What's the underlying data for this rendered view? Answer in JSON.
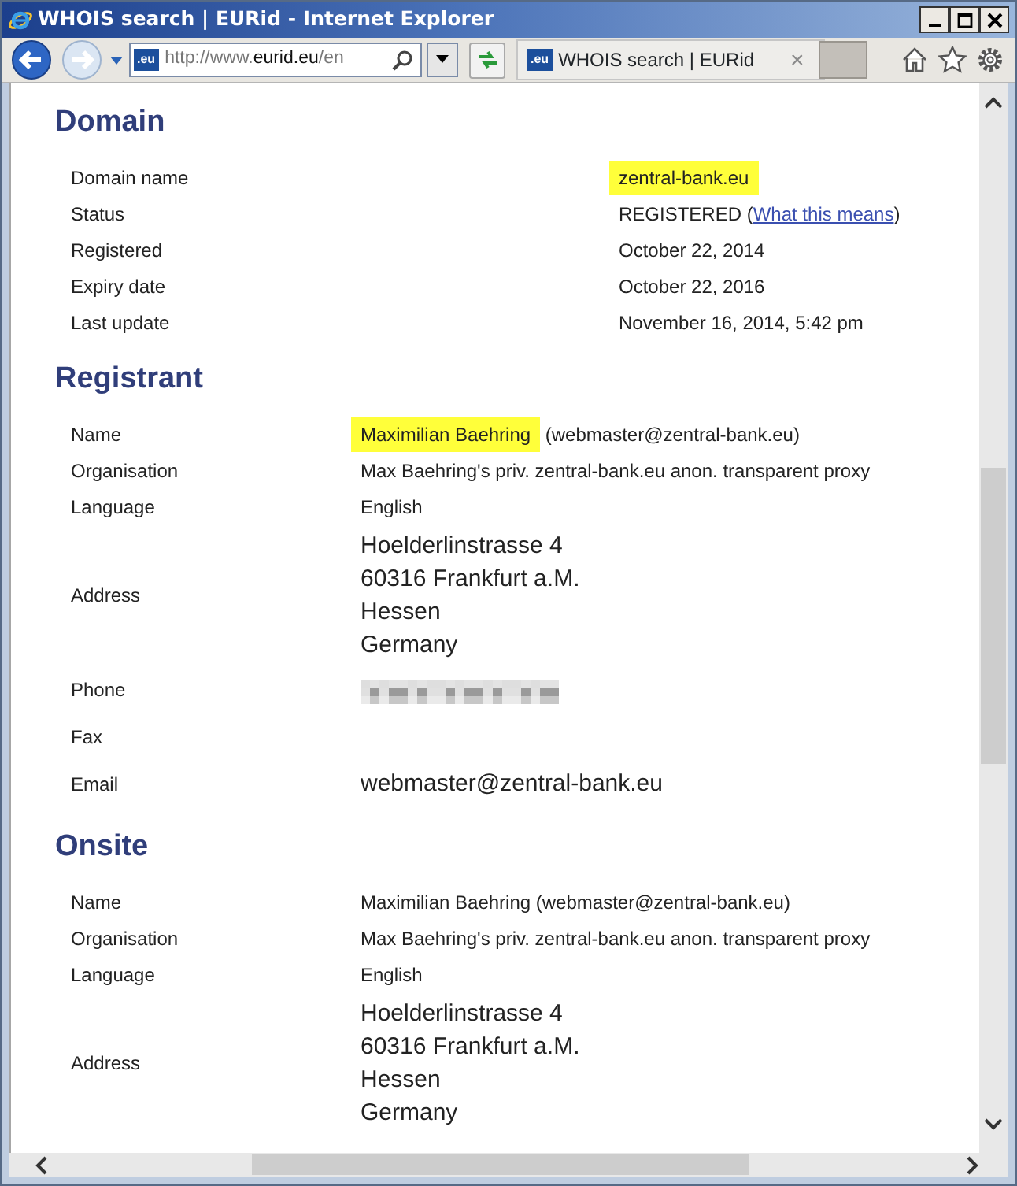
{
  "window": {
    "title": "WHOIS search | EURid - Internet Explorer"
  },
  "address_bar": {
    "favicon": ".eu",
    "url_prefix": "http://www.",
    "url_domain": "eurid.eu",
    "url_suffix": "/en"
  },
  "tabs": [
    {
      "favicon": ".eu",
      "label": "WHOIS search | EURid",
      "selected": true,
      "close": "×"
    }
  ],
  "sections": [
    {
      "title": "Domain",
      "kind": "wide",
      "rows": [
        {
          "label": "Domain name",
          "kind": "text",
          "value": "zentral-bank.eu",
          "highlighted": true
        },
        {
          "label": "Status",
          "kind": "status",
          "value": "REGISTERED",
          "open": "(",
          "link": "What this means",
          "close": ")"
        },
        {
          "label": "Registered",
          "kind": "text",
          "value": "October 22, 2014",
          "highlighted": false
        },
        {
          "label": "Expiry date",
          "kind": "text",
          "value": "October 22, 2016",
          "highlighted": false
        },
        {
          "label": "Last update",
          "kind": "text",
          "value": "November 16, 2014, 5:42 pm",
          "highlighted": false
        }
      ]
    },
    {
      "title": "Registrant",
      "kind": "narrow",
      "rows": [
        {
          "label": "Name",
          "kind": "text",
          "value": "Maximilian Baehring",
          "highlighted": true,
          "suffix": "(webmaster@zentral-bank.eu)"
        },
        {
          "label": "Organisation",
          "kind": "text",
          "value": "Max Baehring's priv. zentral-bank.eu anon. transparent proxy",
          "highlighted": false
        },
        {
          "label": "Language",
          "kind": "text",
          "value": "English",
          "highlighted": false
        },
        {
          "label": "Address",
          "kind": "address",
          "lines": [
            "Hoelderlinstrasse 4",
            "60316 Frankfurt a.M.",
            "Hessen",
            "Germany"
          ]
        },
        {
          "label": "Phone",
          "kind": "redacted"
        },
        {
          "label": "Fax",
          "kind": "empty"
        },
        {
          "label": "Email",
          "kind": "large",
          "value": "webmaster@zentral-bank.eu"
        }
      ]
    },
    {
      "title": "Onsite",
      "kind": "narrow",
      "rows": [
        {
          "label": "Name",
          "kind": "text",
          "value": "Maximilian Baehring",
          "highlighted": false,
          "suffix": "(webmaster@zentral-bank.eu)"
        },
        {
          "label": "Organisation",
          "kind": "text",
          "value": "Max Baehring's priv. zentral-bank.eu anon. transparent proxy",
          "highlighted": false
        },
        {
          "label": "Language",
          "kind": "text",
          "value": "English",
          "highlighted": false
        },
        {
          "label": "Address",
          "kind": "address",
          "lines": [
            "Hoelderlinstrasse 4",
            "60316 Frankfurt a.M.",
            "Hessen",
            "Germany"
          ]
        }
      ]
    }
  ]
}
